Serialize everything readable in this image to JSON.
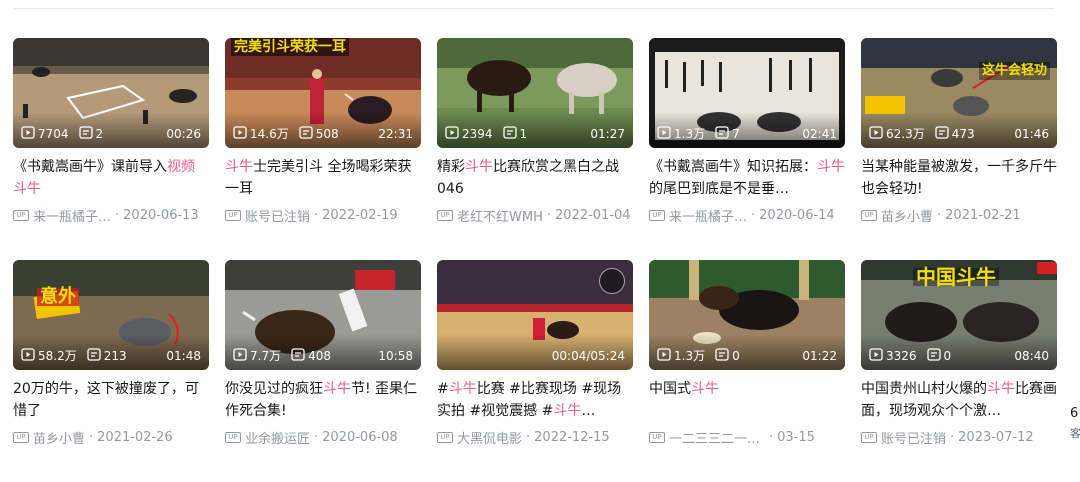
{
  "cards": [
    {
      "title_parts": [
        {
          "t": "《书戴嵩画牛》课前导入"
        },
        {
          "t": "视频",
          "hl": true
        },
        {
          "t": " "
        },
        {
          "t": "斗牛",
          "hl": true
        }
      ],
      "views": "7704",
      "comments": "2",
      "duration": "00:26",
      "author": "来一瓶橘子…",
      "date": "2020-06-13",
      "overlay": ""
    },
    {
      "title_parts": [
        {
          "t": "斗牛",
          "hl": true
        },
        {
          "t": "士完美引斗 全场喝彩荣获一耳"
        }
      ],
      "views": "14.6万",
      "comments": "508",
      "duration": "22:31",
      "author": "账号已注销",
      "date": "2022-02-19",
      "overlay": "完美引斗荣获一耳"
    },
    {
      "title_parts": [
        {
          "t": "精彩"
        },
        {
          "t": "斗牛",
          "hl": true
        },
        {
          "t": "比赛欣赏之黑白之战 046"
        }
      ],
      "views": "2394",
      "comments": "1",
      "duration": "01:27",
      "author": "老红不红WMH",
      "date": "2022-01-04",
      "overlay": ""
    },
    {
      "title_parts": [
        {
          "t": "《书戴嵩画牛》知识拓展："
        },
        {
          "t": "斗牛",
          "hl": true
        },
        {
          "t": "的尾巴到底是不是垂…"
        }
      ],
      "views": "1.3万",
      "comments": "7",
      "duration": "02:41",
      "author": "来一瓶橘子…",
      "date": "2020-06-14",
      "overlay": ""
    },
    {
      "title_parts": [
        {
          "t": "当某种能量被激发，一千多斤牛也会轻功!"
        }
      ],
      "views": "62.3万",
      "comments": "473",
      "duration": "01:46",
      "author": "苗乡小曹",
      "date": "2021-02-21",
      "overlay": "这牛会轻功"
    },
    {
      "title_parts": [
        {
          "t": "20万的牛，这下被撞废了，可惜了"
        }
      ],
      "views": "58.2万",
      "comments": "213",
      "duration": "01:48",
      "author": "苗乡小曹",
      "date": "2021-02-26",
      "overlay": "意外"
    },
    {
      "title_parts": [
        {
          "t": "你没见过的疯狂"
        },
        {
          "t": "斗牛",
          "hl": true
        },
        {
          "t": "节! 歪果仁作死合集!"
        }
      ],
      "views": "7.7万",
      "comments": "408",
      "duration": "10:58",
      "author": "业余搬运匠",
      "date": "2020-06-08",
      "overlay": ""
    },
    {
      "title_parts": [
        {
          "t": "#"
        },
        {
          "t": "斗牛",
          "hl": true
        },
        {
          "t": "比赛 #比赛现场 #现场实拍 #视觉震撼 #"
        },
        {
          "t": "斗牛",
          "hl": true
        },
        {
          "t": "…"
        }
      ],
      "views": "",
      "comments": "",
      "duration": "00:04/05:24",
      "author": "大黑侃电影",
      "date": "2022-12-15",
      "overlay": ""
    },
    {
      "title_parts": [
        {
          "t": "中国式"
        },
        {
          "t": "斗牛",
          "hl": true
        }
      ],
      "views": "1.3万",
      "comments": "0",
      "duration": "01:22",
      "author": "一二三三二一开干",
      "date": "03-15",
      "overlay": ""
    },
    {
      "title_parts": [
        {
          "t": "中国贵州山村火爆的"
        },
        {
          "t": "斗牛",
          "hl": true
        },
        {
          "t": "比赛画面，现场观众个个激…"
        }
      ],
      "views": "3326",
      "comments": "0",
      "duration": "08:40",
      "author": "账号已注销",
      "date": "2023-07-12",
      "overlay": "中国斗牛"
    }
  ],
  "side": {
    "line1": "6",
    "line2": "客"
  },
  "colors": {
    "highlight": "#f25d8e",
    "meta": "#9499a0"
  }
}
